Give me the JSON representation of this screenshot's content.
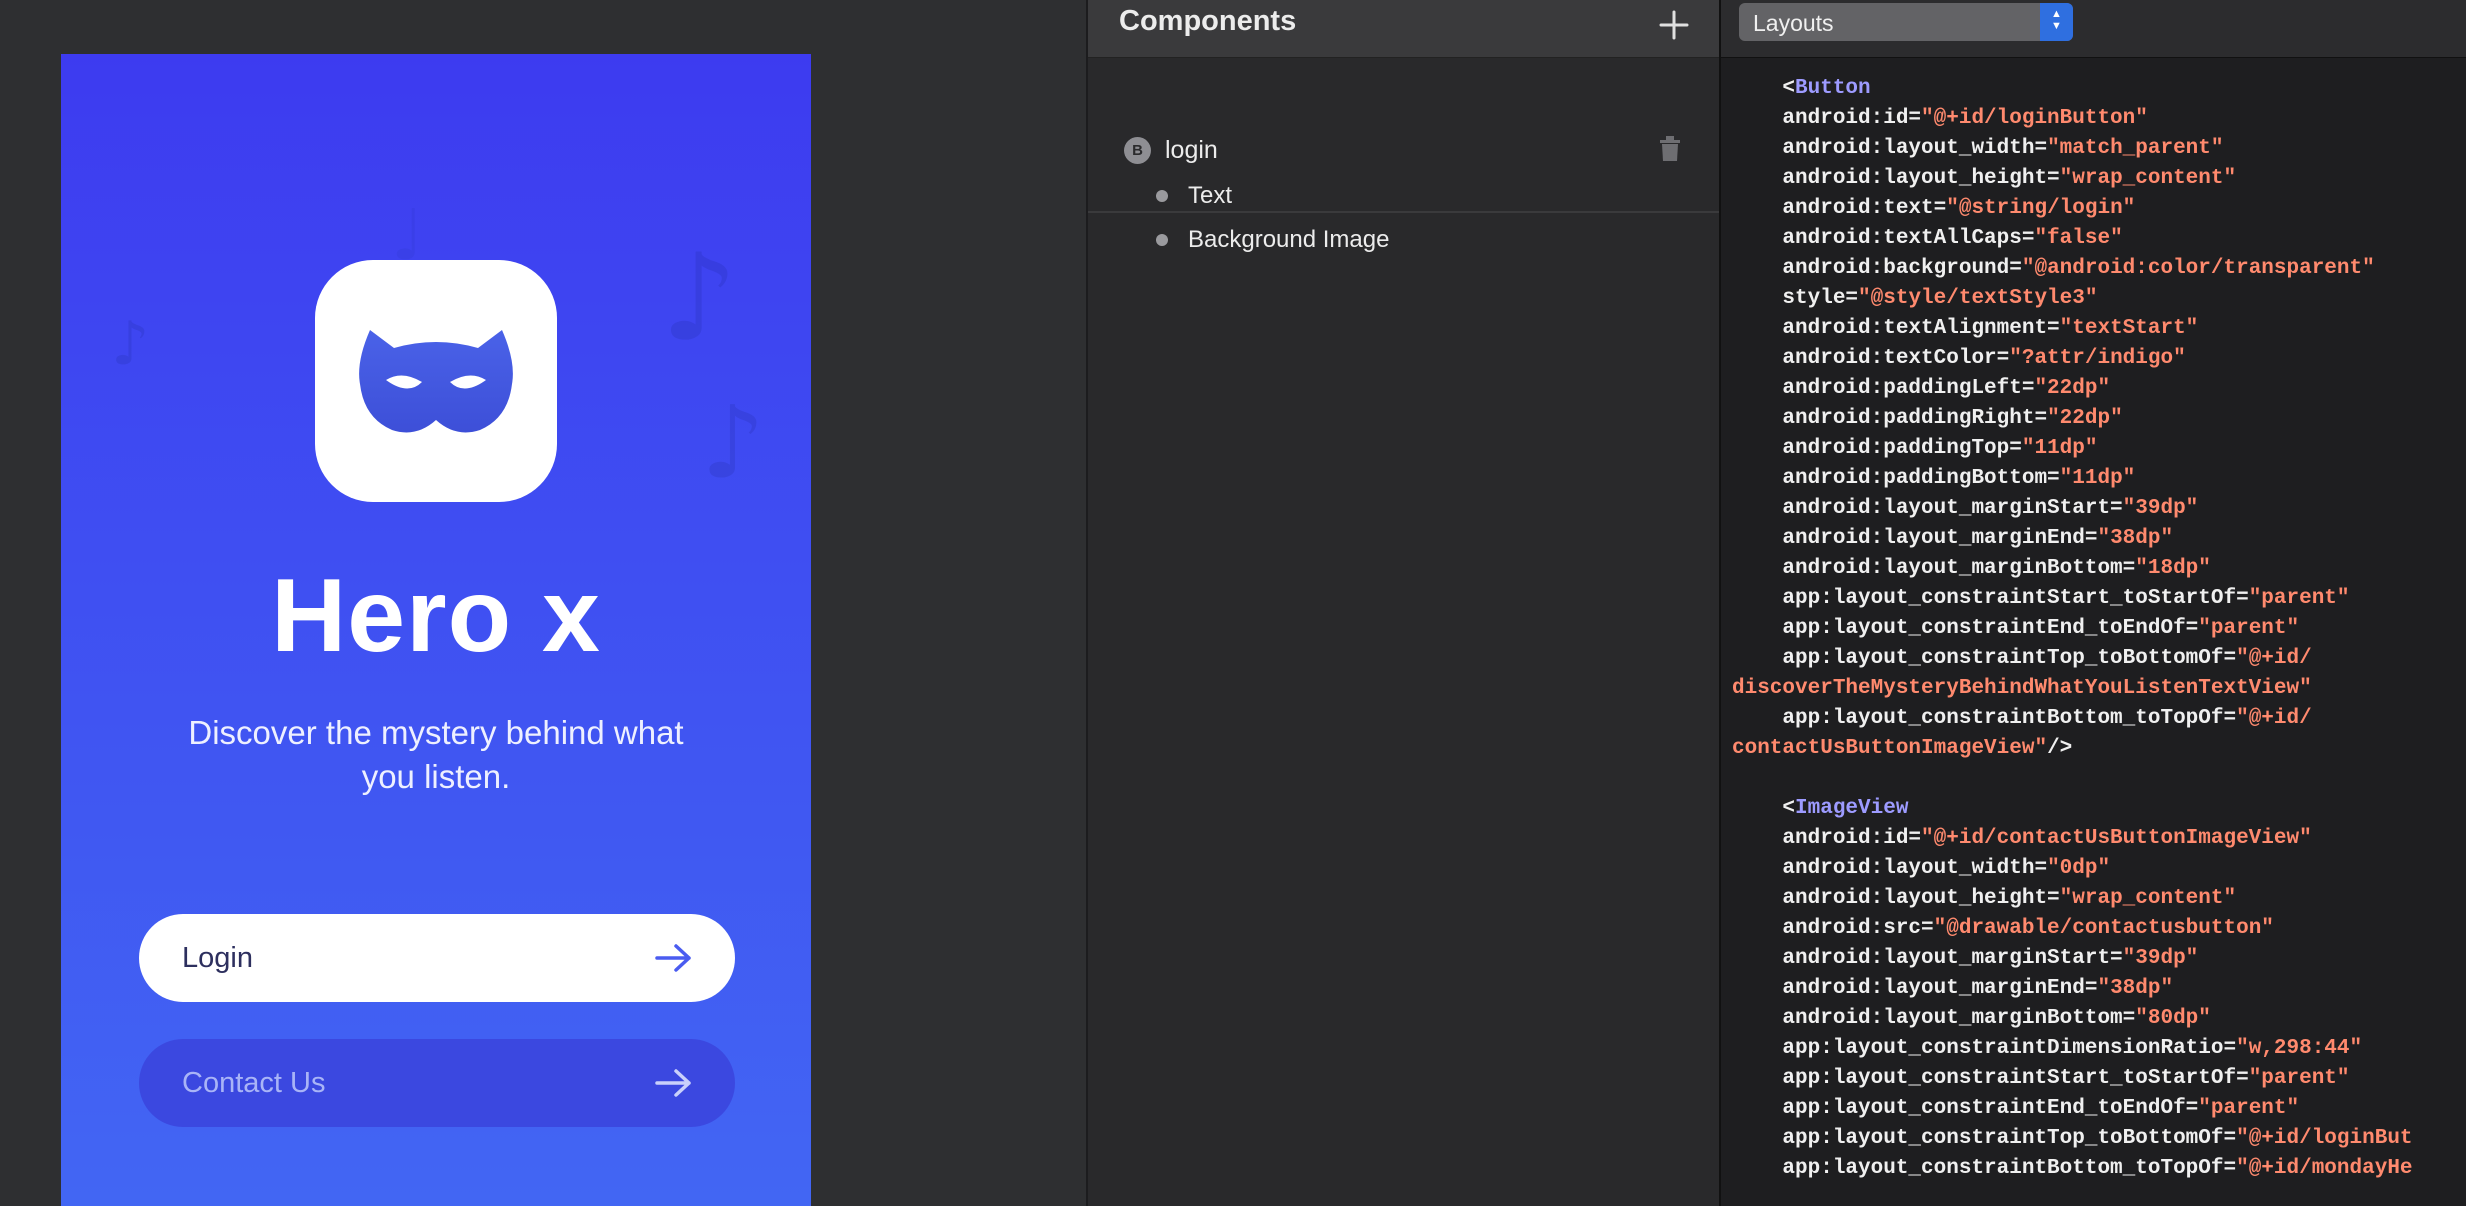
{
  "preview": {
    "app_name": "Hero x",
    "subtitle": "Discover the mystery behind what you listen.",
    "login_label": "Login",
    "contact_label": "Contact Us",
    "colors": {
      "gradient_top": "#3d3bf0",
      "gradient_bottom": "#4266f3",
      "contact_button": "#3b48e0"
    }
  },
  "components": {
    "title": "Components",
    "add_icon": "plus-icon",
    "root": {
      "badge": "B",
      "label": "login"
    },
    "delete_icon": "trash-icon",
    "children": [
      {
        "label": "Text"
      },
      {
        "label": "Background Image"
      }
    ]
  },
  "code": {
    "select_value": "Layouts",
    "lines": [
      [
        [
          "p",
          "    <"
        ],
        [
          "t",
          "Button"
        ]
      ],
      [
        [
          "p",
          "    android:id="
        ],
        [
          "v",
          "\"@+id/loginButton\""
        ]
      ],
      [
        [
          "p",
          "    android:layout_width="
        ],
        [
          "v",
          "\"match_parent\""
        ]
      ],
      [
        [
          "p",
          "    android:layout_height="
        ],
        [
          "v",
          "\"wrap_content\""
        ]
      ],
      [
        [
          "p",
          "    android:text="
        ],
        [
          "v",
          "\"@string/login\""
        ]
      ],
      [
        [
          "p",
          "    android:textAllCaps="
        ],
        [
          "v",
          "\"false\""
        ]
      ],
      [
        [
          "p",
          "    android:background="
        ],
        [
          "v",
          "\"@android:color/transparent\""
        ]
      ],
      [
        [
          "p",
          "    style="
        ],
        [
          "v",
          "\"@style/textStyle3\""
        ]
      ],
      [
        [
          "p",
          "    android:textAlignment="
        ],
        [
          "v",
          "\"textStart\""
        ]
      ],
      [
        [
          "p",
          "    android:textColor="
        ],
        [
          "v",
          "\"?attr/indigo\""
        ]
      ],
      [
        [
          "p",
          "    android:paddingLeft="
        ],
        [
          "v",
          "\"22dp\""
        ]
      ],
      [
        [
          "p",
          "    android:paddingRight="
        ],
        [
          "v",
          "\"22dp\""
        ]
      ],
      [
        [
          "p",
          "    android:paddingTop="
        ],
        [
          "v",
          "\"11dp\""
        ]
      ],
      [
        [
          "p",
          "    android:paddingBottom="
        ],
        [
          "v",
          "\"11dp\""
        ]
      ],
      [
        [
          "p",
          "    android:layout_marginStart="
        ],
        [
          "v",
          "\"39dp\""
        ]
      ],
      [
        [
          "p",
          "    android:layout_marginEnd="
        ],
        [
          "v",
          "\"38dp\""
        ]
      ],
      [
        [
          "p",
          "    android:layout_marginBottom="
        ],
        [
          "v",
          "\"18dp\""
        ]
      ],
      [
        [
          "p",
          "    app:layout_constraintStart_toStartOf="
        ],
        [
          "v",
          "\"parent\""
        ]
      ],
      [
        [
          "p",
          "    app:layout_constraintEnd_toEndOf="
        ],
        [
          "v",
          "\"parent\""
        ]
      ],
      [
        [
          "p",
          "    app:layout_constraintTop_toBottomOf="
        ],
        [
          "v",
          "\"@+id/"
        ]
      ],
      [
        [
          "v",
          "discoverTheMysteryBehindWhatYouListenTextView\""
        ]
      ],
      [
        [
          "p",
          "    app:layout_constraintBottom_toTopOf="
        ],
        [
          "v",
          "\"@+id/"
        ]
      ],
      [
        [
          "v",
          "contactUsButtonImageView\""
        ],
        [
          "p",
          "/>"
        ]
      ],
      [
        [
          "p",
          ""
        ]
      ],
      [
        [
          "p",
          "    <"
        ],
        [
          "t",
          "ImageView"
        ]
      ],
      [
        [
          "p",
          "    android:id="
        ],
        [
          "v",
          "\"@+id/contactUsButtonImageView\""
        ]
      ],
      [
        [
          "p",
          "    android:layout_width="
        ],
        [
          "v",
          "\"0dp\""
        ]
      ],
      [
        [
          "p",
          "    android:layout_height="
        ],
        [
          "v",
          "\"wrap_content\""
        ]
      ],
      [
        [
          "p",
          "    android:src="
        ],
        [
          "v",
          "\"@drawable/contactusbutton\""
        ]
      ],
      [
        [
          "p",
          "    android:layout_marginStart="
        ],
        [
          "v",
          "\"39dp\""
        ]
      ],
      [
        [
          "p",
          "    android:layout_marginEnd="
        ],
        [
          "v",
          "\"38dp\""
        ]
      ],
      [
        [
          "p",
          "    android:layout_marginBottom="
        ],
        [
          "v",
          "\"80dp\""
        ]
      ],
      [
        [
          "p",
          "    app:layout_constraintDimensionRatio="
        ],
        [
          "v",
          "\"w,298:44\""
        ]
      ],
      [
        [
          "p",
          "    app:layout_constraintStart_toStartOf="
        ],
        [
          "v",
          "\"parent\""
        ]
      ],
      [
        [
          "p",
          "    app:layout_constraintEnd_toEndOf="
        ],
        [
          "v",
          "\"parent\""
        ]
      ],
      [
        [
          "p",
          "    app:layout_constraintTop_toBottomOf="
        ],
        [
          "v",
          "\"@+id/loginBut"
        ]
      ],
      [
        [
          "p",
          "    app:layout_constraintBottom_toTopOf="
        ],
        [
          "v",
          "\"@+id/mondayHe"
        ]
      ]
    ]
  }
}
